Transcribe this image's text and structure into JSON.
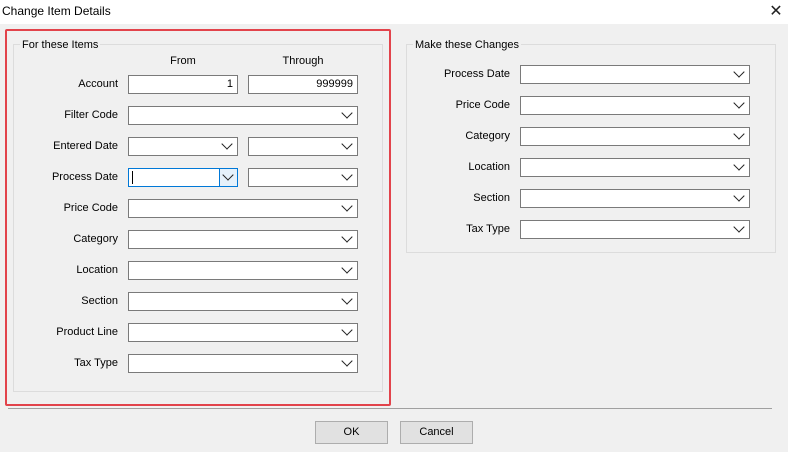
{
  "window": {
    "title": "Change Item Details"
  },
  "left_group": {
    "title": "For these Items",
    "col_from": "From",
    "col_through": "Through",
    "rows": {
      "account": {
        "label": "Account",
        "from": "1",
        "through": "999999"
      },
      "filter_code": {
        "label": "Filter Code"
      },
      "entered_date": {
        "label": "Entered Date"
      },
      "process_date": {
        "label": "Process Date"
      },
      "price_code": {
        "label": "Price Code"
      },
      "category": {
        "label": "Category"
      },
      "location": {
        "label": "Location"
      },
      "section": {
        "label": "Section"
      },
      "product_line": {
        "label": "Product Line"
      },
      "tax_type": {
        "label": "Tax Type"
      }
    }
  },
  "right_group": {
    "title": "Make these Changes",
    "rows": {
      "process_date": {
        "label": "Process Date"
      },
      "price_code": {
        "label": "Price Code"
      },
      "category": {
        "label": "Category"
      },
      "location": {
        "label": "Location"
      },
      "section": {
        "label": "Section"
      },
      "tax_type": {
        "label": "Tax Type"
      }
    }
  },
  "buttons": {
    "ok": "OK",
    "cancel": "Cancel"
  },
  "icons": {
    "close": "close-icon",
    "dropdown": "chevron-down-icon"
  },
  "colors": {
    "highlight": "#e2434b",
    "focus": "#0078d7"
  }
}
